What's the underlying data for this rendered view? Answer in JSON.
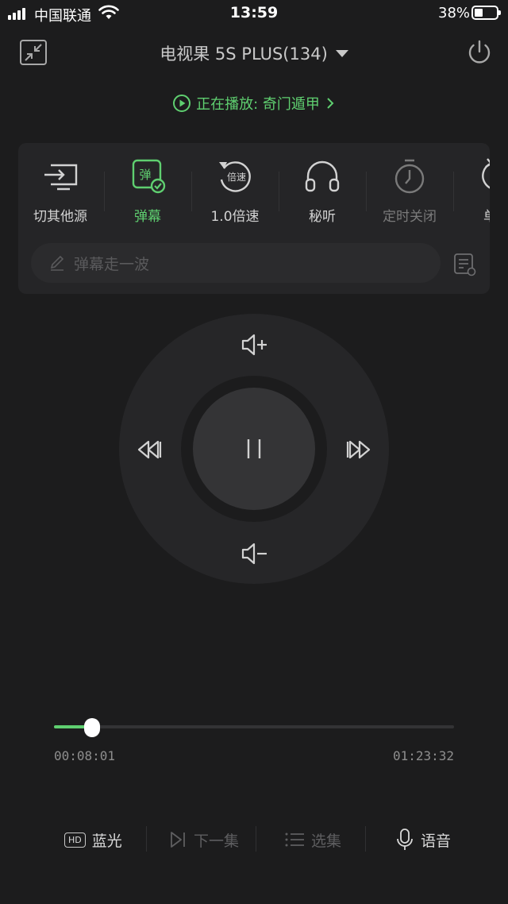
{
  "status_bar": {
    "carrier": "中国联通",
    "time": "13:59",
    "battery_percent": "38%",
    "battery_level": 0.38
  },
  "header": {
    "device_name": "电视果 5S PLUS(134)",
    "now_playing_label": "正在播放: 奇门遁甲",
    "icons": [
      "shrink-icon",
      "power-icon"
    ]
  },
  "functions": [
    {
      "label": "切其他源",
      "icon": "cast-screen-icon",
      "state": "normal"
    },
    {
      "label": "弹幕",
      "icon": "danmu-icon",
      "icon_text": "弹",
      "state": "active"
    },
    {
      "label": "1.0倍速",
      "icon": "speed-icon",
      "icon_text": "倍速",
      "state": "normal"
    },
    {
      "label": "秘听",
      "icon": "headphones-icon",
      "state": "normal"
    },
    {
      "label": "定时关闭",
      "icon": "timer-icon",
      "state": "disabled"
    },
    {
      "label": "单片",
      "icon": "loop-icon",
      "state": "normal"
    }
  ],
  "danmu": {
    "placeholder": "弹幕走一波"
  },
  "remote": {
    "buttons": [
      "volume-up",
      "volume-down",
      "rewind",
      "fast-forward",
      "pause"
    ]
  },
  "progress": {
    "current": "00:08:01",
    "total": "01:23:32",
    "fraction": 0.096
  },
  "bottom_bar": {
    "quality_badge": "HD",
    "quality_label": "蓝光",
    "next_label": "下一集",
    "episodes_label": "选集",
    "voice_label": "语音"
  },
  "colors": {
    "accent": "#5fcf70",
    "background": "#1c1c1d",
    "panel": "#252527"
  }
}
